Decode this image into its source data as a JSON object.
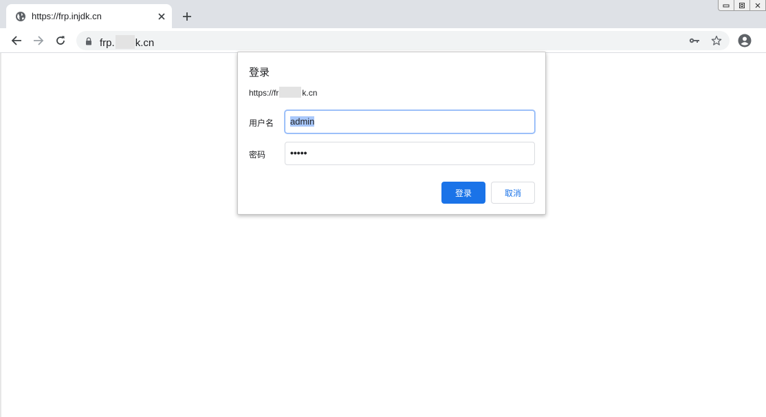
{
  "tab": {
    "title": "https://frp.injdk.cn",
    "favicon": "globe-icon",
    "close_icon": "close-icon",
    "new_tab_icon": "plus-icon"
  },
  "window_controls": [
    "minimize-icon",
    "restore-icon",
    "close-icon"
  ],
  "toolbar": {
    "back_icon": "arrow-left-icon",
    "forward_icon": "arrow-right-icon",
    "reload_icon": "reload-icon",
    "url_prefix": "frp.",
    "url_suffix": "k.cn",
    "lock_icon": "lock-icon",
    "key_icon": "key-icon",
    "star_icon": "star-icon",
    "profile_icon": "account-circle-icon"
  },
  "dialog": {
    "title": "登录",
    "origin_prefix": "https://fr",
    "origin_suffix": "k.cn",
    "username_label": "用户名",
    "username_value": "admin",
    "password_label": "密码",
    "password_value": "•••••",
    "submit_label": "登录",
    "cancel_label": "取消"
  },
  "colors": {
    "accent": "#1a73e8",
    "tabstrip": "#dee1e6",
    "omnibox": "#f1f3f4",
    "selection": "#a8c7fa"
  }
}
